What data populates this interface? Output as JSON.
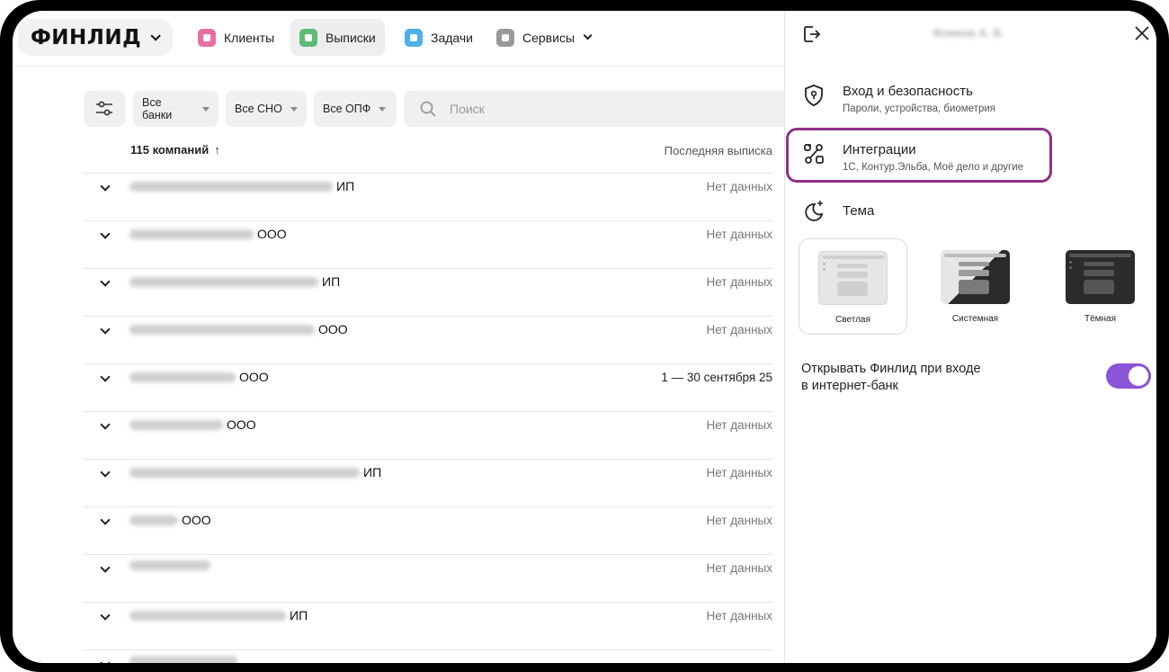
{
  "nav": {
    "logo": "ФИНЛИД",
    "items": [
      {
        "label": "Клиенты",
        "icon": "briefcase-icon",
        "color": "#e66fa3"
      },
      {
        "label": "Выписки",
        "icon": "document-icon",
        "color": "#5fba77"
      },
      {
        "label": "Задачи",
        "icon": "stack-icon",
        "color": "#4fb0e8"
      },
      {
        "label": "Сервисы",
        "icon": "grid-icon",
        "color": "#9a9a9a"
      }
    ]
  },
  "filters": {
    "banks": "Все банки",
    "sno": "Все СНО",
    "opf": "Все ОПФ",
    "search_placeholder": "Поиск"
  },
  "list": {
    "count": "115 компаний",
    "sort_arrow": "↑",
    "last_col": "Последняя выписка",
    "rows": [
      {
        "type": "ИП",
        "date": "Нет данных"
      },
      {
        "type": "ООО",
        "date": "Нет данных"
      },
      {
        "type": "ИП",
        "date": "Нет данных"
      },
      {
        "type": "ООО",
        "date": "Нет данных"
      },
      {
        "type": "ООО",
        "date": "1 — 30 сентября 25"
      },
      {
        "type": "ООО",
        "date": "Нет данных"
      },
      {
        "type": "ИП",
        "date": "Нет данных"
      },
      {
        "type": "ООО",
        "date": "Нет данных"
      },
      {
        "type": "",
        "date": "Нет данных"
      },
      {
        "type": "ИП",
        "date": "Нет данных"
      }
    ]
  },
  "panel": {
    "user_name": "Фомина А. В.",
    "security_title": "Вход и безопасность",
    "security_sub": "Пароли, устройства, биометрия",
    "integrations_title": "Интеграции",
    "integrations_sub": "1С, Контур.Эльба, Моё дело и другие",
    "theme_title": "Тема",
    "themes": [
      "Светлая",
      "Системная",
      "Тёмная"
    ],
    "open_label_1": "Открывать Финлид при входе",
    "open_label_2": "в интернет-банк",
    "toggle_on": true,
    "accent": "#8b54d9",
    "highlight_color": "#8e3187"
  }
}
